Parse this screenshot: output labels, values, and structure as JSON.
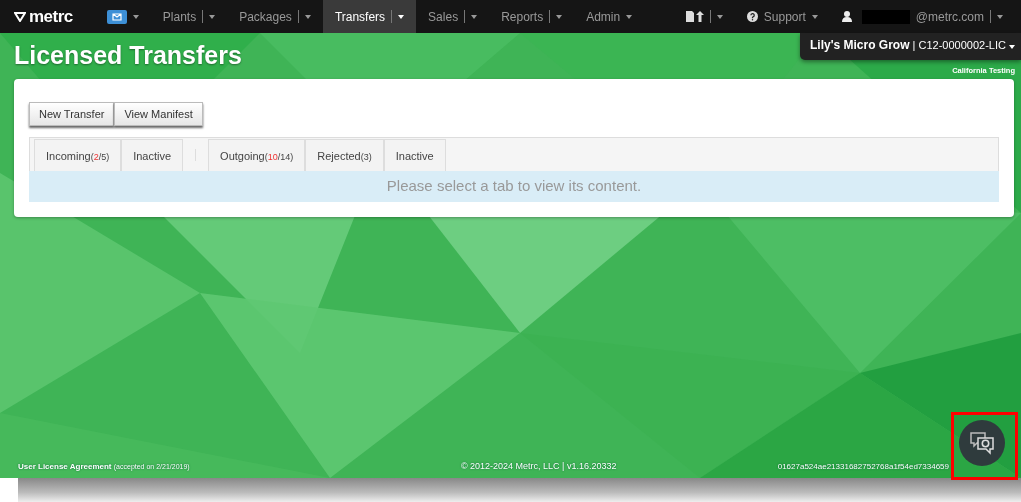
{
  "navbar": {
    "logo": "metrc",
    "items": [
      {
        "kind": "mail",
        "selected": false
      },
      {
        "kind": "menu",
        "label": "Plants",
        "split": true,
        "selected": false
      },
      {
        "kind": "menu",
        "label": "Packages",
        "split": true,
        "selected": false
      },
      {
        "kind": "menu",
        "label": "Transfers",
        "split": true,
        "selected": true
      },
      {
        "kind": "menu",
        "label": "Sales",
        "split": true,
        "selected": false
      },
      {
        "kind": "menu",
        "label": "Reports",
        "split": true,
        "selected": false
      },
      {
        "kind": "menu",
        "label": "Admin",
        "split": false,
        "selected": false
      }
    ],
    "support": "Support",
    "user_email": "@metrc.com"
  },
  "page_title": "Licensed Transfers",
  "facility": {
    "name": "Lily's Micro Grow",
    "separator": "|",
    "license": "C12-0000002-LIC",
    "environment": "California Testing"
  },
  "buttons": [
    "New Transfer",
    "View Manifest"
  ],
  "tabs": [
    {
      "label": "Incoming",
      "count": {
        "prefix": "(",
        "alert": "2",
        "rest": "/5)"
      },
      "selected": false
    },
    {
      "label": "Inactive",
      "selected": false
    },
    {
      "kind": "separator"
    },
    {
      "label": "Outgoing",
      "count": {
        "prefix": "(",
        "alert": "10",
        "rest": "/14)"
      },
      "selected": false
    },
    {
      "label": "Rejected",
      "count": {
        "prefix": "(3)"
      },
      "selected": false
    },
    {
      "label": "Inactive",
      "selected": false
    }
  ],
  "tab_message": "Please select a tab to view its content.",
  "footer": {
    "agreement": "User License Agreement",
    "accepted": "(accepted on 2/21/2019)",
    "copyright": "© 2012-2024 Metrc, LLC  | v1.16.20332",
    "hash": "01627a524ae21331682752768a1f54ed7334659"
  },
  "chat_button": {
    "highlighted": true
  }
}
